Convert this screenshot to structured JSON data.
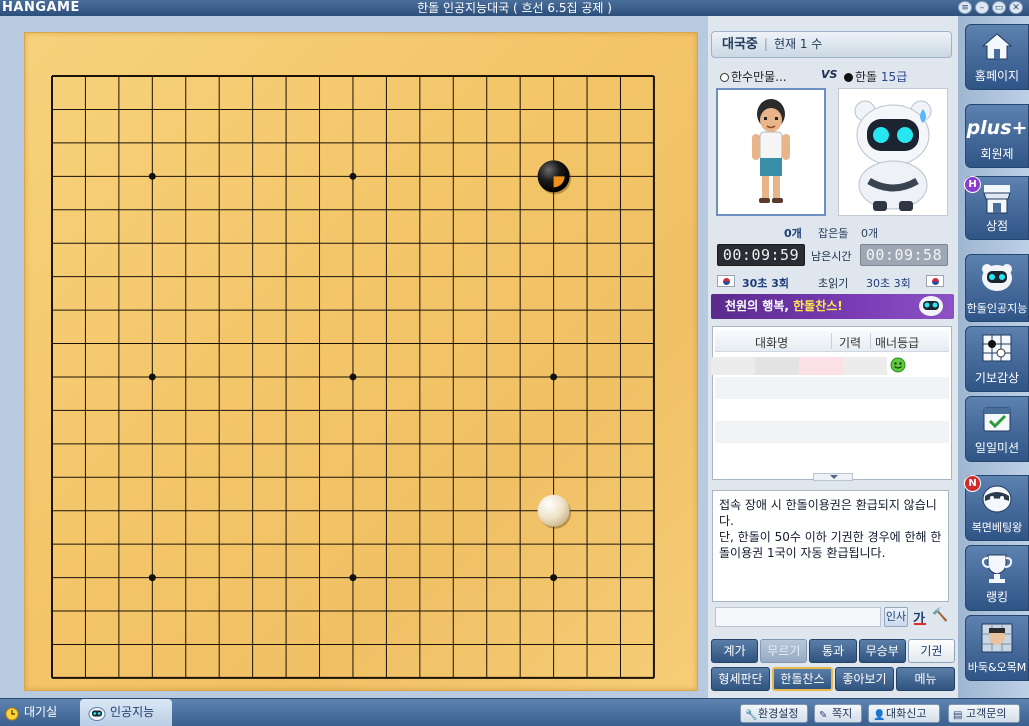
{
  "window": {
    "logo": "HANGAME",
    "title": "한돌 인공지능대국 ( 흐선 6.5집 공제 )",
    "controls": [
      "≡",
      "–",
      "▭",
      "✕"
    ]
  },
  "board": {
    "size": 19,
    "star_points": [
      [
        3,
        3
      ],
      [
        3,
        9
      ],
      [
        3,
        15
      ],
      [
        9,
        3
      ],
      [
        9,
        9
      ],
      [
        9,
        15
      ],
      [
        15,
        3
      ],
      [
        15,
        9
      ],
      [
        15,
        15
      ]
    ],
    "stones": [
      {
        "color": "black",
        "col": 15,
        "row": 3,
        "last_move": true
      },
      {
        "color": "white",
        "col": 15,
        "row": 13,
        "last_move": false
      }
    ]
  },
  "status": {
    "state": "대국중",
    "move_info": "현재 1 수"
  },
  "players": {
    "left": {
      "name": "한수만물...",
      "stone": "white"
    },
    "vs": "VS",
    "right": {
      "name": "한돌",
      "rank": "15급",
      "stone": "black"
    }
  },
  "captures": {
    "left": "0개",
    "label": "잡은돌",
    "right": "0개"
  },
  "timers": {
    "left": "00:09:59",
    "label": "남은시간",
    "right": "00:09:58"
  },
  "byoyomi": {
    "left": "30초 3회",
    "label": "초읽기",
    "right": "30초 3회"
  },
  "promo": {
    "text_a": "천원의 행복, ",
    "text_b": "한돌찬스!"
  },
  "chat_list": {
    "columns": [
      "대화명",
      "기력",
      "매너등급"
    ]
  },
  "notice": {
    "text": "접속 장애 시 한돌이용권은 환급되지 않습니다.\n단, 한돌이 50수 이하 기권한 경우에 한해 한돌이용권 1국이 자동 환급됩니다."
  },
  "chat_input": {
    "greet_label": "인사",
    "font_label": "가",
    "tool_label": "🔨"
  },
  "game_buttons": {
    "row1": [
      "계가",
      "무르기",
      "통과",
      "무승부",
      "기권"
    ],
    "row2": [
      "형세판단",
      "한돌찬스",
      "좋아보기",
      "메뉴"
    ]
  },
  "side_menu": [
    {
      "label": "홈페이지",
      "icon": "home-icon"
    },
    {
      "label": "회원제",
      "icon": "plus-icon",
      "icon_text": "plus+"
    },
    {
      "label": "상점",
      "icon": "shop-icon",
      "badge": "H"
    },
    {
      "label": "한돌인공지능",
      "icon": "robot-icon"
    },
    {
      "label": "기보감상",
      "icon": "game-record-icon"
    },
    {
      "label": "일일미션",
      "icon": "calendar-check-icon"
    },
    {
      "label": "복면베팅왕",
      "icon": "mask-icon",
      "badge": "N"
    },
    {
      "label": "랭킹",
      "icon": "trophy-icon"
    },
    {
      "label": "바둑&오목M",
      "icon": "mobile-game-icon"
    }
  ],
  "bottom": {
    "tab_lobby": "대기실",
    "tab_ai": "인공지능",
    "settings": "환경설정",
    "memo": "쪽지",
    "chat_request": "대화신고",
    "support": "고객문의"
  },
  "colors": {
    "board": "#f4c66a",
    "accent": "#2f547f",
    "promo": "#7b3cb6"
  }
}
